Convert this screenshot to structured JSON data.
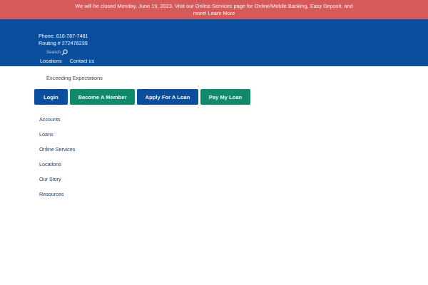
{
  "alert": {
    "line1": "We will be closed Monday, June 19, 2023. Visit our Online Services page for Online/Mobile Banking, Easy Deposit, and",
    "line2": "more!",
    "link": "Learn More"
  },
  "header": {
    "phone": "Phone: 616-787-7481",
    "routing": "Routing # 272476239",
    "search_placeholder": "Search",
    "util_links": [
      "Locations",
      "Contact us"
    ]
  },
  "tagline": "Exceeding Expectations",
  "cta_buttons": [
    {
      "label": "Login",
      "color": "#0a4f9e"
    },
    {
      "label": "Become A Member",
      "color": "#0f8a6a"
    },
    {
      "label": "Apply For A Loan",
      "color": "#0a4f9e"
    },
    {
      "label": "Pay My Loan",
      "color": "#0f8a6a"
    }
  ],
  "main_nav": [
    "Accounts",
    "Loans",
    "Online Services",
    "Locations",
    "Our Story",
    "Resources"
  ],
  "colors": {
    "alert": "#d65a5a",
    "header": "#0a4f9e",
    "green": "#0f8a6a"
  }
}
